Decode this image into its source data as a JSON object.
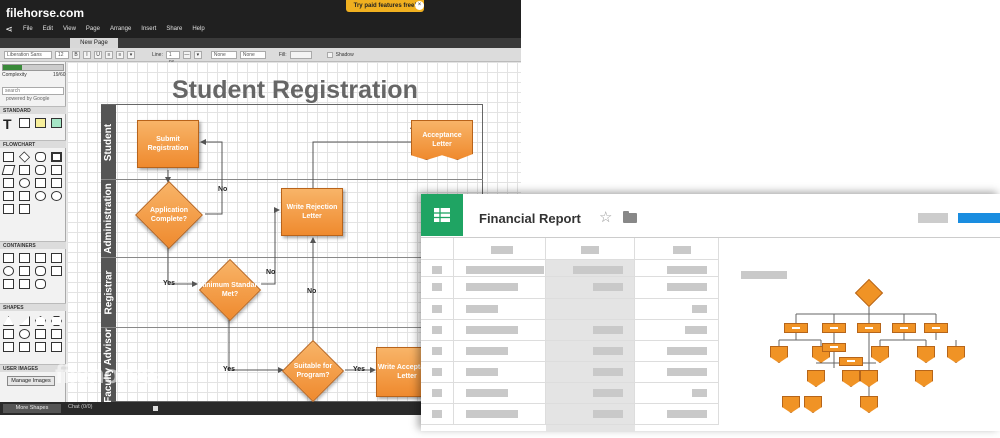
{
  "editor": {
    "brand": "filehorse.com",
    "promo": "Try paid features free!",
    "menu": [
      "File",
      "Edit",
      "View",
      "Page",
      "Arrange",
      "Insert",
      "Share",
      "Help"
    ],
    "page_tab": "New Page",
    "toolbar": {
      "font": "Liberation Sans",
      "size": "12",
      "bold": "B",
      "italic": "I",
      "underline": "U",
      "line_label": "Line:",
      "line_value": "1 px",
      "fill_label": "Fill:",
      "shadow_label": "Shadow",
      "none_1": "None",
      "none_2": "None"
    },
    "left_panel": {
      "complexity_label": "Complexity",
      "complexity_value": "19/60",
      "complexity_fraction": 0.32,
      "search_placeholder": "search",
      "powered_by": "powered by Google",
      "sections": [
        "STANDARD",
        "FLOWCHART",
        "CONTAINERS",
        "SHAPES",
        "USER IMAGES"
      ],
      "standard_glyph": "T",
      "manage_images": "Manage Images"
    },
    "bottom": {
      "more_shapes": "More Shapes",
      "chat": "Chat (0/0)"
    },
    "diagram": {
      "title": "Student Registration",
      "lanes": [
        "Student",
        "Administration",
        "Registrar",
        "Faculty Advisor"
      ],
      "nodes": {
        "submit": "Submit Registration",
        "acceptance": "Acceptance Letter",
        "app_complete": "Application Complete?",
        "rejection": "Write Rejection Letter",
        "min_std": "Minimum Standard Met?",
        "suitable": "Suitable for Program?",
        "write_accept": "Write Acceptance Letter"
      },
      "labels": {
        "no_1": "No",
        "no_2": "No",
        "no_3": "No",
        "yes_1": "Yes",
        "yes_2": "Yes",
        "yes_3": "Yes"
      }
    },
    "watermark": "filehorse",
    "watermark_suffix": ".com"
  },
  "sheet": {
    "title": "Financial Report",
    "icon": "spreadsheet-icon",
    "star_icon": "star-icon",
    "folder_icon": "folder-icon",
    "accent_color": "#1fa463",
    "button_color": "#1a8de0"
  }
}
